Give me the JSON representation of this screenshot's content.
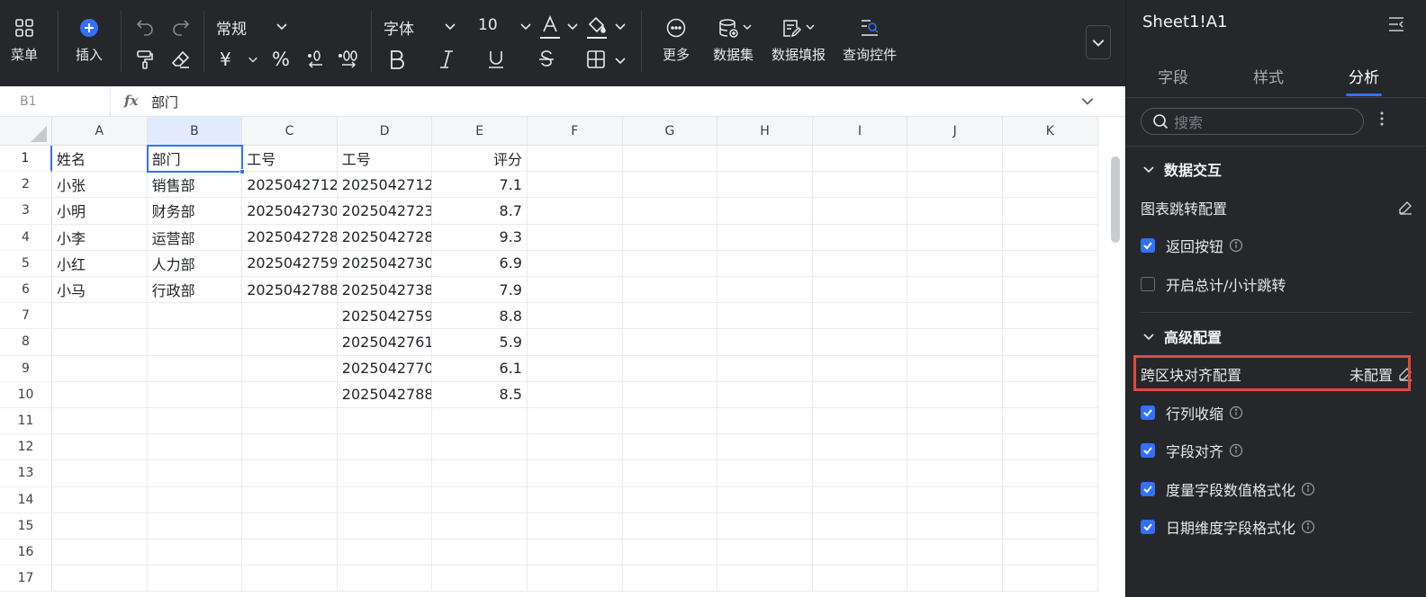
{
  "toolbar": {
    "menu_label": "菜单",
    "insert_label": "插入",
    "number_format": "常规",
    "font_name": "字体",
    "font_size": "10",
    "more_label": "更多",
    "dataset_label": "数据集",
    "fill_label": "数据填报",
    "query_label": "查询控件",
    "accent_color": "#3370ff"
  },
  "formula_bar": {
    "cell_ref": "B1",
    "fx": "fx",
    "value": "部门"
  },
  "grid": {
    "columns": [
      "A",
      "B",
      "C",
      "D",
      "E",
      "F",
      "G",
      "H",
      "I",
      "J",
      "K"
    ],
    "row_numbers": [
      "1",
      "2",
      "3",
      "4",
      "5",
      "6",
      "7",
      "8",
      "9",
      "10",
      "11",
      "12",
      "13",
      "14",
      "15",
      "16",
      "17"
    ],
    "selected_cell": "B1",
    "rows": [
      [
        "姓名",
        "部门",
        "工号",
        "工号",
        "评分"
      ],
      [
        "小张",
        "销售部",
        "2025042712",
        "2025042712",
        "7.1"
      ],
      [
        "小明",
        "财务部",
        "2025042730",
        "2025042723",
        "8.7"
      ],
      [
        "小李",
        "运营部",
        "2025042728",
        "2025042728",
        "9.3"
      ],
      [
        "小红",
        "人力部",
        "2025042759",
        "2025042730",
        "6.9"
      ],
      [
        "小马",
        "行政部",
        "2025042788",
        "2025042738",
        "7.9"
      ],
      [
        "",
        "",
        "",
        "2025042759",
        "8.8"
      ],
      [
        "",
        "",
        "",
        "2025042761",
        "5.9"
      ],
      [
        "",
        "",
        "",
        "2025042770",
        "6.1"
      ],
      [
        "",
        "",
        "",
        "2025042788",
        "8.5"
      ]
    ]
  },
  "panel": {
    "title": "Sheet1!A1",
    "tabs": [
      "字段",
      "样式",
      "分析"
    ],
    "active_tab": "分析",
    "search_placeholder": "搜索",
    "section1": {
      "title": "数据交互",
      "chart_jump_label": "图表跳转配置",
      "return_button_label": "返回按钮",
      "return_button_checked": true,
      "total_jump_label": "开启总计/小计跳转",
      "total_jump_checked": false
    },
    "section2": {
      "title": "高级配置",
      "cross_align_label": "跨区块对齐配置",
      "cross_align_status": "未配置",
      "collapse_label": "行列收缩",
      "field_align_label": "字段对齐",
      "measure_format_label": "度量字段数值格式化",
      "date_format_label": "日期维度字段格式化"
    },
    "highlight_color": "#e5483b"
  }
}
